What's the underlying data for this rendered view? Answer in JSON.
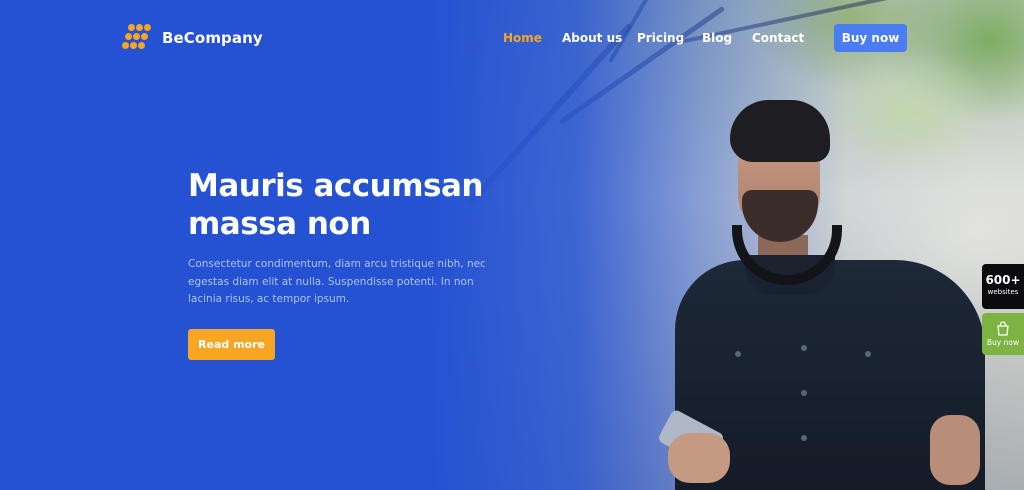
{
  "brand": {
    "name": "BeCompany",
    "accent": "#f6a623",
    "primary": "#2452d2"
  },
  "nav": {
    "items": [
      {
        "label": "Home",
        "active": true
      },
      {
        "label": "About us",
        "active": false
      },
      {
        "label": "Pricing",
        "active": false
      },
      {
        "label": "Blog",
        "active": false
      },
      {
        "label": "Contact",
        "active": false
      }
    ],
    "cta_label": "Buy now"
  },
  "hero": {
    "headline_line1": "Mauris accumsan",
    "headline_line2": "massa non",
    "subtext": "Consectetur condimentum, diam arcu tristique nibh, nec egestas diam elit at nulla. Suspendisse potenti. In non lacinia risus, ac tempor ipsum.",
    "button_label": "Read more"
  },
  "side_widgets": {
    "websites_count": "600+",
    "websites_label": "websites",
    "buy_label": "Buy now",
    "buy_icon": "shopping-bag-icon"
  }
}
